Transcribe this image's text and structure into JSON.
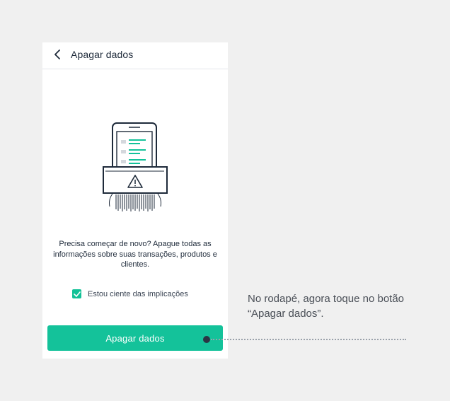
{
  "header": {
    "title": "Apagar dados",
    "back_icon": "chevron-left-icon"
  },
  "illustration": {
    "icon": "phone-shredder-illustration",
    "accent_color": "#14c29a",
    "stroke_color": "#1e2a3a"
  },
  "main": {
    "description": "Precisa começar de novo? Apague todas as informações sobre suas transações, produtos e clientes.",
    "checkbox_label": "Estou ciente das implicações",
    "checkbox_checked": true,
    "primary_button_label": "Apagar dados"
  },
  "annotation": {
    "text": "No rodapé, agora toque no botão “Apagar dados”."
  },
  "colors": {
    "brand": "#14c29a",
    "text_dark": "#1e2a3a",
    "background": "#f0f0f0"
  }
}
